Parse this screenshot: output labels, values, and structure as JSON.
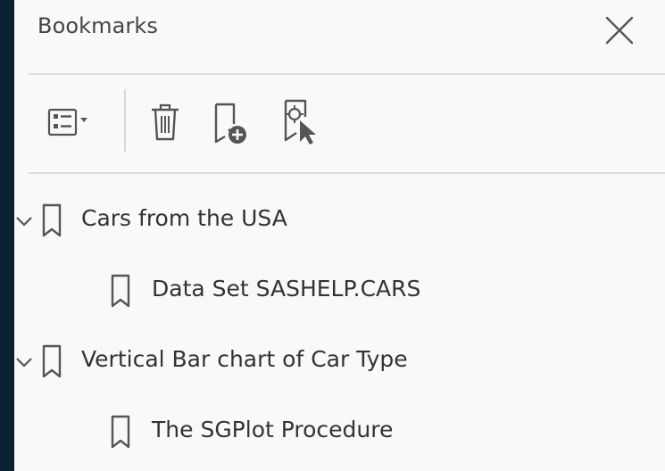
{
  "panel": {
    "title": "Bookmarks",
    "close_icon": "close-icon"
  },
  "toolbar": {
    "buttons": [
      {
        "name": "options-menu",
        "icon": "list-options-icon"
      },
      {
        "name": "delete-bookmark",
        "icon": "trash-icon"
      },
      {
        "name": "new-bookmark",
        "icon": "bookmark-add-icon"
      },
      {
        "name": "expand-current-bookmark",
        "icon": "bookmark-find-icon"
      }
    ]
  },
  "bookmarks": [
    {
      "label": "Cars from the USA",
      "level": 0,
      "expanded": true
    },
    {
      "label": "Data Set SASHELP.CARS",
      "level": 1
    },
    {
      "label": "Vertical Bar chart of Car Type",
      "level": 0,
      "expanded": true
    },
    {
      "label": "The SGPlot Procedure",
      "level": 1
    }
  ],
  "colors": {
    "outer_background": "#0b2233",
    "panel_background": "#f9f9f9",
    "icon": "#555555",
    "divider": "#dddddd"
  }
}
